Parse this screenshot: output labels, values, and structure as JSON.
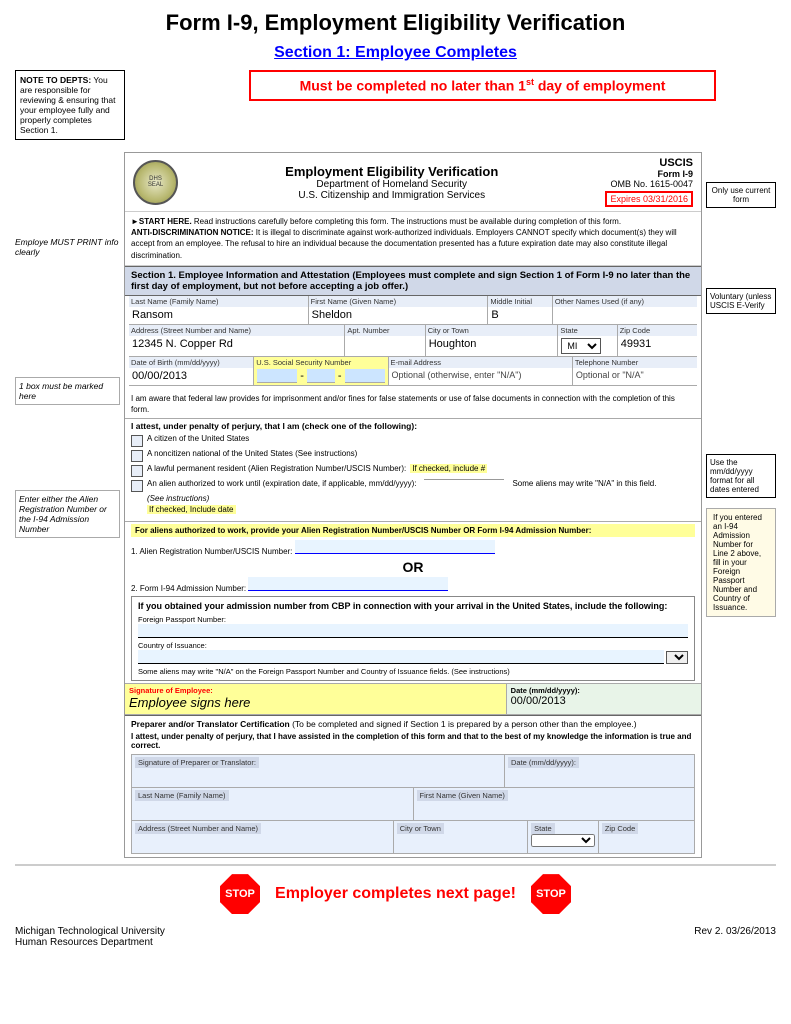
{
  "page": {
    "main_title": "Form I-9, Employment Eligibility Verification",
    "section_title": "Section 1: Employee Completes",
    "must_complete": "Must be completed no later than 1",
    "must_complete_sup": "st",
    "must_complete_end": " day of employment",
    "note_to_depts_label": "NOTE TO DEPTS:",
    "note_to_depts_body": "You are responsible for reviewing & ensuring that your employee fully and properly completes Section 1.",
    "uscis_label": "USCIS",
    "form_num": "Form I-9",
    "omb_num": "OMB No. 1615-0047",
    "expires": "Expires 03/31/2016",
    "ev_title": "Employment Eligibility Verification",
    "dhs": "Department of Homeland Security",
    "uscis_full": "U.S. Citizenship and Immigration Services",
    "start_here_bold": "►START HERE.",
    "start_here_text": " Read instructions carefully before completing this form. The instructions must be available during completion of this form.",
    "anti_disc": "ANTI-DISCRIMINATION NOTICE:",
    "anti_disc_text": " It is illegal to discriminate against work-authorized individuals. Employers CANNOT specify which document(s) they will accept from an employee. The refusal to hire an individual because the documentation presented has a future expiration date may also constitute illegal discrimination.",
    "section1_title": "Section 1. Employee Information and Attestation",
    "section1_subtitle": " (Employees must complete and sign Section 1 of Form I-9 no later than the first day of employment, but not before accepting a job offer.)",
    "fields": {
      "last_name_label": "Last Name (Family Name)",
      "last_name_value": "Ransom",
      "first_name_label": "First Name (Given Name)",
      "first_name_value": "Sheldon",
      "middle_initial_label": "Middle Initial",
      "middle_initial_value": "B",
      "other_names_label": "Other Names Used (if any)",
      "other_names_value": "",
      "address_label": "Address (Street Number and Name)",
      "address_value": "12345 N. Copper Rd",
      "apt_label": "Apt. Number",
      "apt_value": "",
      "city_label": "City or Town",
      "city_value": "Houghton",
      "state_label": "State",
      "state_value": "MI",
      "zip_label": "Zip Code",
      "zip_value": "49931",
      "dob_label": "Date of Birth (mm/dd/yyyy)",
      "dob_value": "00/00/2013",
      "ssn_label": "U.S. Social Security Number",
      "email_label": "E-mail Address",
      "email_placeholder": "Optional (otherwise, enter \"N/A\")",
      "phone_label": "Telephone Number",
      "phone_placeholder": "Optional or \"N/A\""
    },
    "attestation_text": "I am aware that federal law provides for imprisonment and/or fines for false statements or use of false documents in connection with the completion of this form.",
    "attest_header": "I attest, under penalty of perjury, that I am (check one of the following):",
    "checkboxes": [
      "A citizen of the United States",
      "A noncitizen national of the United States (See instructions)",
      "A lawful permanent resident (Alien Registration Number/USCIS Number):",
      "An alien authorized to work until (expiration date, if applicable, mm/dd/yyyy):"
    ],
    "if_checked_include": "If checked, include #",
    "if_checked_date": "If checked, Include date",
    "alien_section_text": "For aliens authorized to work, provide your Alien Registration Number/USCIS Number OR Form I-94 Admission Number:",
    "alien_line1_label": "1. Alien Registration Number/USCIS Number:",
    "or_label": "OR",
    "alien_line2_label": "2. Form I-94 Admission Number:",
    "i94_intro": "If you obtained your admission number from CBP in connection with your arrival in the United States, include the following:",
    "i94_passport_label": "Foreign Passport Number:",
    "i94_country_label": "Country of Issuance:",
    "i94_note": "If you entered an I-94 Admission Number for Line 2 above, fill in your Foreign Passport Number and Country of Issuance.",
    "na_note": "Some aliens may write \"N/A\" on the Foreign Passport Number and Country of Issuance fields. (See instructions)",
    "sig_employee_label": "Signature of Employee:",
    "sig_employee_value": "Employee signs here",
    "date_label": "Date (mm/dd/yyyy):",
    "date_value": "00/00/2013",
    "preparer_title": "Preparer and/or Translator Certification",
    "preparer_subtitle": " (To be completed and signed if Section 1 is prepared by a person other than the employee.)",
    "preparer_attest": "I attest, under penalty of perjury, that I have assisted in the completion of this form and that to the best of my knowledge the information is true and correct.",
    "preparer_sig_label": "Signature of Preparer or Translator:",
    "preparer_date_label": "Date (mm/dd/yyyy):",
    "preparer_last_label": "Last Name (Family Name)",
    "preparer_first_label": "First Name (Given Name)",
    "preparer_address_label": "Address (Street Number and Name)",
    "preparer_city_label": "City or Town",
    "preparer_state_label": "State",
    "preparer_zip_label": "Zip Code",
    "bottom_text": "Employer completes next page!",
    "footer_left": "Michigan Technological University\nHuman Resources Department",
    "footer_right": "Rev 2. 03/26/2013",
    "annotations": {
      "employee_must": "Employe MUST PRINT info clearly",
      "one_box": "1 box must be marked here",
      "enter_alien": "Enter either the Alien Registration Number or the I-94 Admission Number",
      "only_use": "Only use current form",
      "voluntary": "Voluntary (unless USCIS E-Verify",
      "use_format": "Use the mm/dd/yyyy format for all dates entered"
    }
  }
}
